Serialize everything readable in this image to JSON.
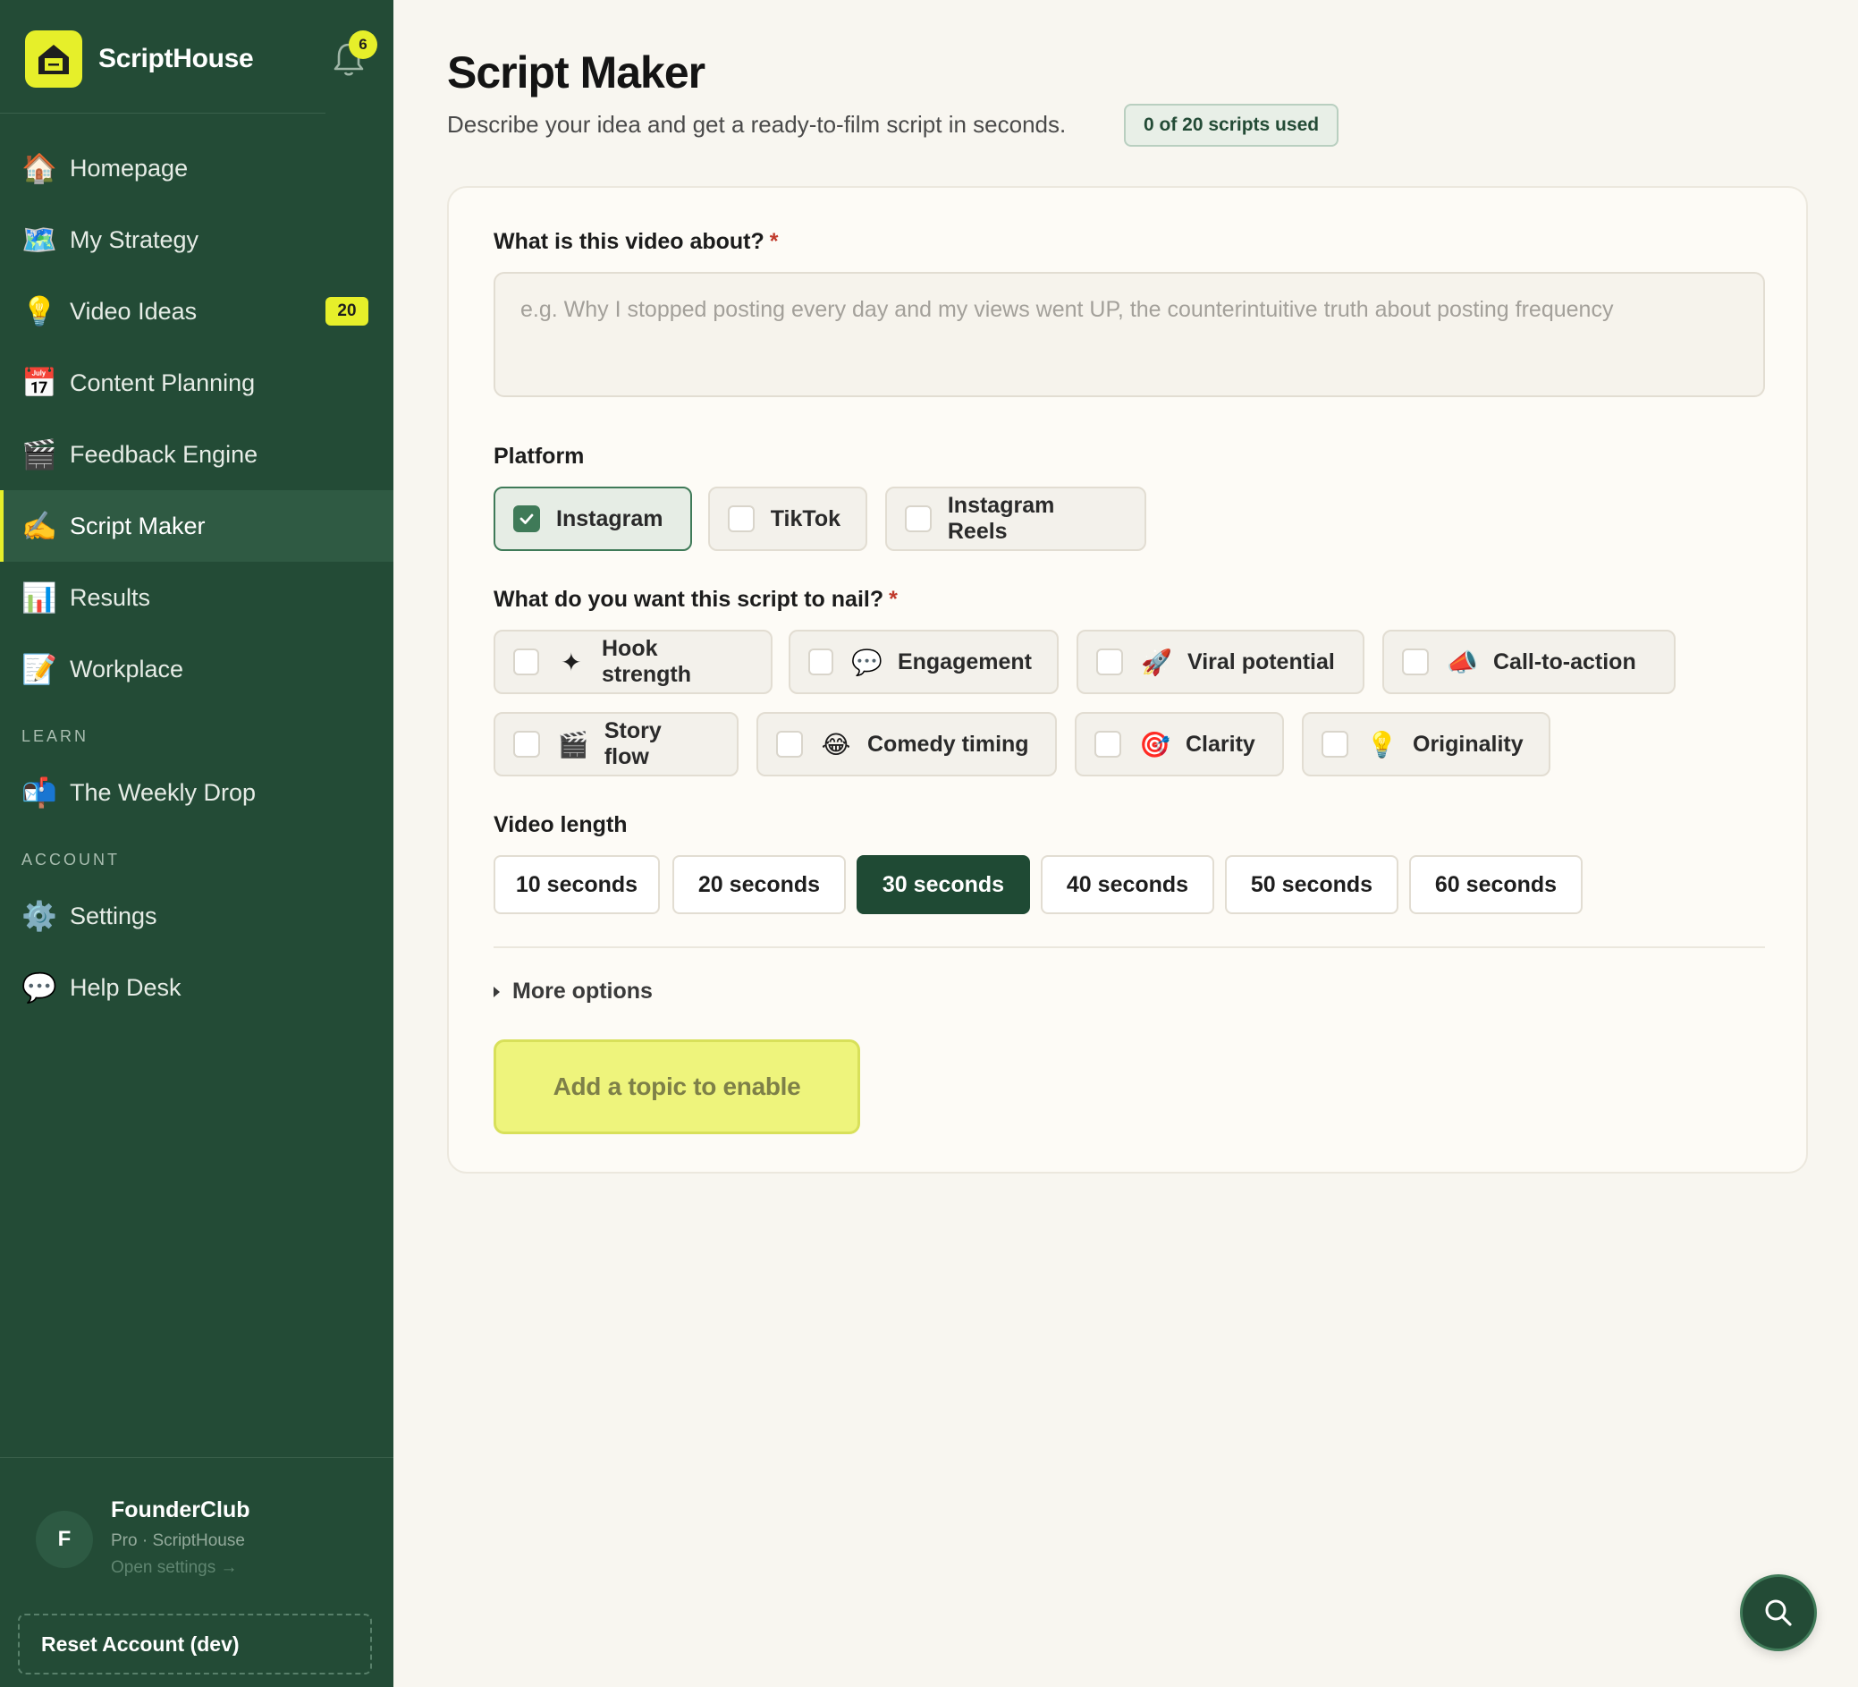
{
  "brand": {
    "name": "ScriptHouse",
    "notification_count": "6"
  },
  "sidebar": {
    "items": [
      {
        "label": "Homepage",
        "emoji": "🏠"
      },
      {
        "label": "My Strategy",
        "emoji": "🗺️"
      },
      {
        "label": "Video Ideas",
        "emoji": "💡",
        "count": "20"
      },
      {
        "label": "Content Planning",
        "emoji": "📅"
      },
      {
        "label": "Feedback Engine",
        "emoji": "🎬"
      },
      {
        "label": "Script Maker",
        "emoji": "✍️"
      },
      {
        "label": "Results",
        "emoji": "📊"
      },
      {
        "label": "Workplace",
        "emoji": "📝"
      }
    ],
    "learn_label": "LEARN",
    "learn_items": [
      {
        "label": "The Weekly Drop",
        "emoji": "📬"
      }
    ],
    "account_label": "ACCOUNT",
    "account_items": [
      {
        "label": "Settings",
        "emoji": "⚙️"
      },
      {
        "label": "Help Desk",
        "emoji": "💬"
      }
    ],
    "user": {
      "initial": "F",
      "name": "FounderClub",
      "plan": "Pro · ScriptHouse",
      "open_settings": "Open settings →"
    },
    "reset_label": "Reset Account (dev)"
  },
  "page": {
    "title": "Script Maker",
    "subtitle": "Describe your idea and get a ready-to-film script in seconds.",
    "usage": "0 of 20 scripts used"
  },
  "form": {
    "topic_label": "What is this video about?",
    "required_mark": "*",
    "topic_placeholder": "e.g. Why I stopped posting every day and my views went UP, the counterintuitive truth about posting frequency",
    "platform_label": "Platform",
    "platforms": [
      {
        "label": "Instagram",
        "checked": true
      },
      {
        "label": "TikTok",
        "checked": false
      },
      {
        "label": "Instagram Reels",
        "checked": false
      }
    ],
    "nail_label": "What do you want this script to nail?",
    "goals": [
      {
        "label": "Hook strength",
        "emoji": "✦"
      },
      {
        "label": "Engagement",
        "emoji": "💬"
      },
      {
        "label": "Viral potential",
        "emoji": "🚀"
      },
      {
        "label": "Call-to-action",
        "emoji": "📣"
      },
      {
        "label": "Story flow",
        "emoji": "🎬"
      },
      {
        "label": "Comedy timing",
        "emoji": "😂"
      },
      {
        "label": "Clarity",
        "emoji": "🎯"
      },
      {
        "label": "Originality",
        "emoji": "💡"
      }
    ],
    "length_label": "Video length",
    "lengths": [
      "10 seconds",
      "20 seconds",
      "30 seconds",
      "40 seconds",
      "50 seconds",
      "60 seconds"
    ],
    "selected_length": "30 seconds",
    "more_options": "More options",
    "submit_label": "Add a topic to enable"
  },
  "colors": {
    "sidebar": "#234b36",
    "accent": "#e6ef2a",
    "selected": "#1f4a34",
    "check": "#3f7a58"
  },
  "icons": {
    "bell": "bell-icon",
    "search": "search-icon",
    "caret": "caret-right-icon",
    "check": "check-icon"
  }
}
